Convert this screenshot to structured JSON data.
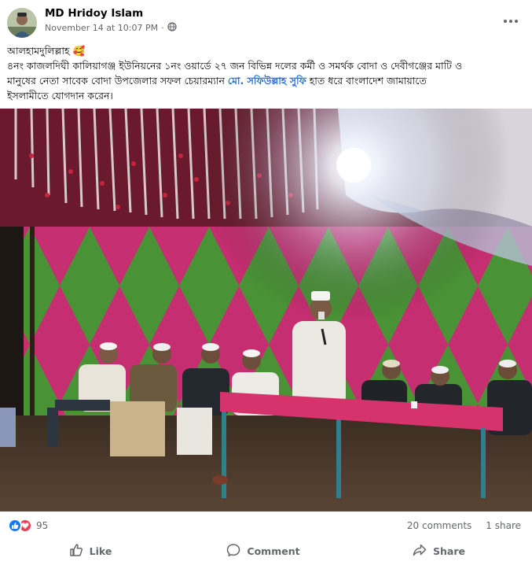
{
  "header": {
    "author": "MD Hridoy Islam",
    "timestamp": "November 14 at 10:07 PM",
    "separator": "·",
    "privacy_icon": "globe-icon",
    "more_icon": "more-dots-icon"
  },
  "body": {
    "line1": "আলহামদুলিল্লাহ",
    "line1_emoji": "🥰",
    "line2": "৪নং কাজলদিঘী কালিয়াগঞ্জ ইউনিয়নের ১নং ওয়ার্ডে ২৭ জন বিভিন্ন দলের কর্মী ও সমর্থক বোদা ও দেবীগঞ্জের মাটি ও",
    "line3_before": "মানুষের নেতা সাবেক বোদা উপজেলার সফল চেয়ারম্যান ",
    "mention": "মো. সফিউল্লাহ সুফি",
    "line3_after": " হাত ধরে বাংলাদেশ জামায়াতে",
    "line4": "ইসলামীতে যোগদান করেন।"
  },
  "reactions": {
    "count": "95",
    "icons": [
      "like-reaction-icon",
      "love-reaction-icon"
    ]
  },
  "stats": {
    "comments": "20 comments",
    "shares": "1 share"
  },
  "actions": {
    "like": "Like",
    "comment": "Comment",
    "share": "Share"
  },
  "colors": {
    "link": "#216fdb",
    "secondary_text": "#65676b",
    "like_blue": "#1877f2",
    "love_red": "#f33e58"
  }
}
